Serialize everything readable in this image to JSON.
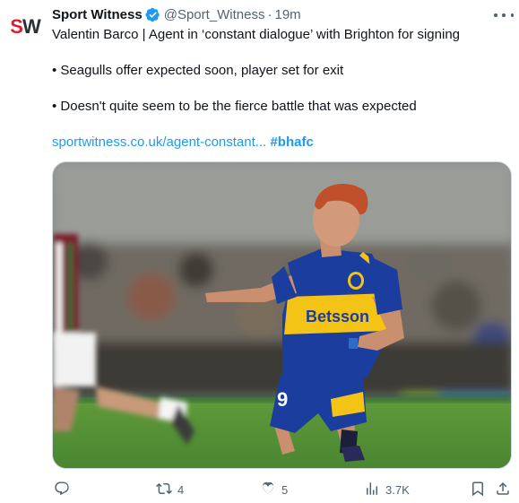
{
  "author": {
    "avatar_text_1": "S",
    "avatar_text_2": "W",
    "name": "Sport Witness",
    "handle": "@Sport_Witness",
    "separator": "·",
    "time": "19m"
  },
  "tweet": {
    "line1": "Valentin Barco | Agent in ‘constant dialogue’ with Brighton for signing",
    "line2": "• Seagulls offer expected soon, player set for exit",
    "line3": "• Doesn't quite seem to be the fierce battle that was expected",
    "link": "sportwitness.co.uk/agent-constant...",
    "hashtag": "#bhafc"
  },
  "media": {
    "sponsor_text": "Betsson",
    "shorts_number": "9"
  },
  "actions": {
    "reply_count": "",
    "retweet_count": "4",
    "like_count": "5",
    "views_count": "3.7K"
  },
  "colors": {
    "brand_red": "#dc1e2d",
    "link_blue": "#1d9bf0",
    "muted_gray": "#536471",
    "verified_blue": "#1d9bf0",
    "boca_blue": "#1a3d9e",
    "boca_gold": "#f3c316"
  },
  "icons": [
    "verified-badge-icon",
    "more-options-icon",
    "reply-icon",
    "retweet-icon",
    "like-icon",
    "views-icon",
    "bookmark-icon",
    "share-icon"
  ]
}
